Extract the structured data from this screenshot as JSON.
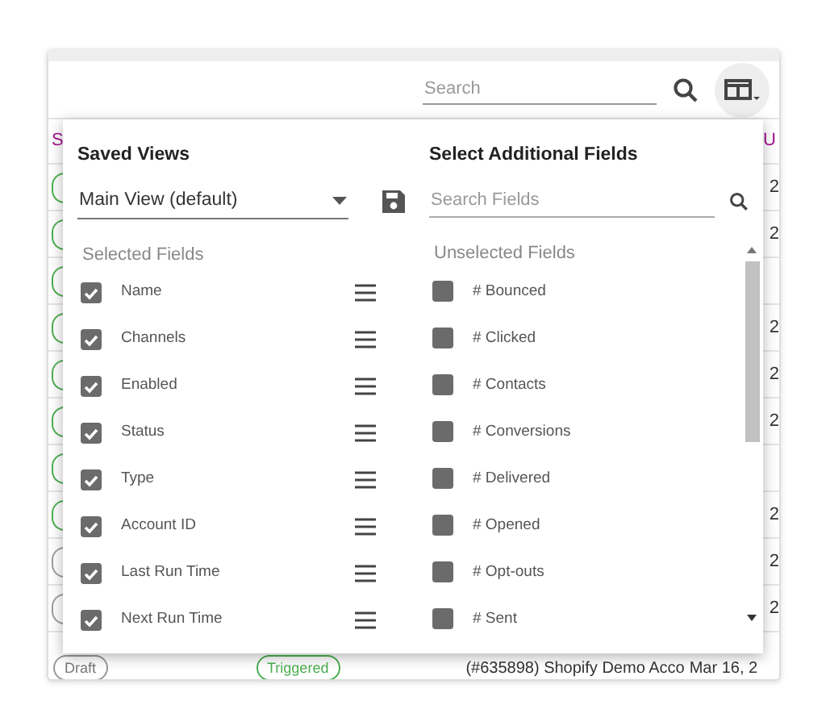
{
  "toolbar": {
    "search": {
      "placeholder": "Search"
    }
  },
  "table": {
    "columns": [
      {
        "label": "S"
      },
      {
        "label": "U"
      }
    ],
    "rows": [
      {
        "color": "#4caf50",
        "column_last": "2"
      },
      {
        "color": "#4caf50",
        "column_last": "2"
      },
      {
        "color": "#4caf50"
      },
      {
        "color": "#4caf50",
        "column_last": "2"
      },
      {
        "color": "#4caf50",
        "column_last": "2"
      },
      {
        "color": "#4caf50",
        "column_last": "2"
      },
      {
        "color": "#4caf50"
      },
      {
        "color": "#4caf50",
        "column_last": "2"
      },
      {
        "color": "#9e9e9e",
        "column_last": "2"
      },
      {
        "color": "#9e9e9e",
        "column_last": "2"
      }
    ],
    "last_row": {
      "status": "Draft",
      "trigger": "Triggered",
      "account": "(#635898) Shopify Demo Acco",
      "date": "Mar 16, 2"
    }
  },
  "popover": {
    "saved_views": {
      "title": "Saved Views",
      "value": "Main View (default)"
    },
    "additional_fields": {
      "title": "Select Additional Fields",
      "placeholder": "Search Fields"
    },
    "selected_fields": {
      "title": "Selected Fields",
      "items": [
        {
          "label": "Name",
          "checked": true
        },
        {
          "label": "Channels",
          "checked": true
        },
        {
          "label": "Enabled",
          "checked": true
        },
        {
          "label": "Status",
          "checked": true
        },
        {
          "label": "Type",
          "checked": true
        },
        {
          "label": "Account ID",
          "checked": true
        },
        {
          "label": "Last Run Time",
          "checked": true
        },
        {
          "label": "Next Run Time",
          "checked": true
        }
      ]
    },
    "unselected_fields": {
      "title": "Unselected Fields",
      "items": [
        {
          "label": "# Bounced",
          "checked": false
        },
        {
          "label": "# Clicked",
          "checked": false
        },
        {
          "label": "# Contacts",
          "checked": false
        },
        {
          "label": "# Conversions",
          "checked": false
        },
        {
          "label": "# Delivered",
          "checked": false
        },
        {
          "label": "# Opened",
          "checked": false
        },
        {
          "label": "# Opt-outs",
          "checked": false
        },
        {
          "label": "# Sent",
          "checked": false
        }
      ]
    }
  }
}
